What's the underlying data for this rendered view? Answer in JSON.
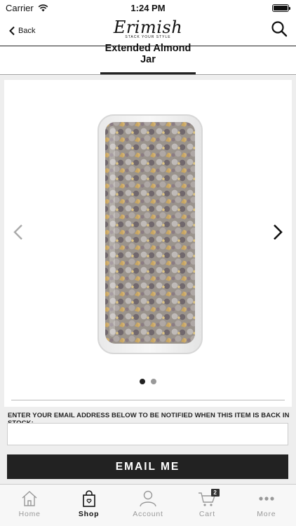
{
  "status_bar": {
    "carrier": "Carrier",
    "time": "1:24 PM"
  },
  "nav": {
    "back_label": "Back",
    "logo_text": "Erimish",
    "logo_tagline": "STACK YOUR STYLE"
  },
  "product": {
    "title": "Extended Almond Jar",
    "image_count": 2,
    "active_image": 1
  },
  "stock_notice": {
    "label": "ENTER YOUR EMAIL ADDRESS BELOW TO BE NOTIFIED WHEN THIS ITEM IS BACK IN STOCK:",
    "email_value": "",
    "button_label": "EMAIL ME"
  },
  "tabs": [
    {
      "label": "Home",
      "icon": "home-icon",
      "active": false
    },
    {
      "label": "Shop",
      "icon": "shopping-bag-icon",
      "active": true
    },
    {
      "label": "Account",
      "icon": "person-icon",
      "active": false
    },
    {
      "label": "Cart",
      "icon": "cart-icon",
      "active": false,
      "badge": "2"
    },
    {
      "label": "More",
      "icon": "more-icon",
      "active": false
    }
  ],
  "colors": {
    "accent": "#222222",
    "background": "#eeeeee",
    "inactive": "#999999"
  }
}
